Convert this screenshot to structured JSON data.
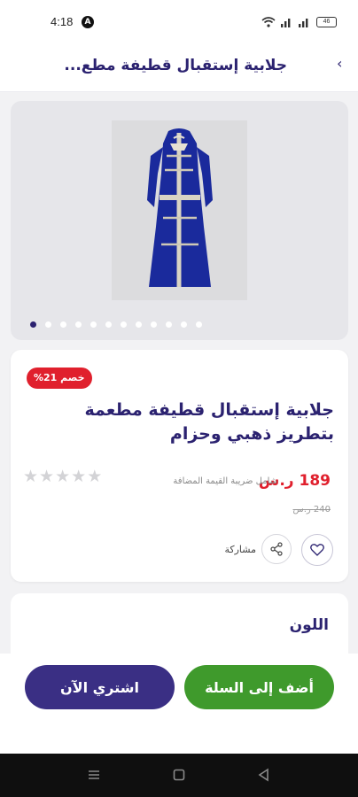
{
  "status_bar": {
    "time": "4:18",
    "a_badge": "A",
    "battery": "46"
  },
  "header": {
    "title": "جلابية إستقبال قطيفة مطع...",
    "back": "‹"
  },
  "gallery": {
    "image_count": 12,
    "active_index": 0
  },
  "product": {
    "discount": "خصم 21%",
    "title": "جلابية إستقبال قطيفة مطعمة بتطريز ذهبي وحزام",
    "rating_stars": 5,
    "rating_value": 0,
    "price": "189 ر.س",
    "vat_note": "شامل ضريبة القيمة المضافة",
    "old_price": "240 ر.س",
    "share_label": "مشاركة"
  },
  "options": {
    "color_label": "اللون"
  },
  "actions": {
    "add_to_cart": "أضف إلى السلة",
    "buy_now": "اشتري الآن"
  },
  "colors": {
    "primary": "#2b2270",
    "discount": "#e0202d",
    "cart_button": "#3f9a2c",
    "buy_button": "#3a2f84"
  }
}
